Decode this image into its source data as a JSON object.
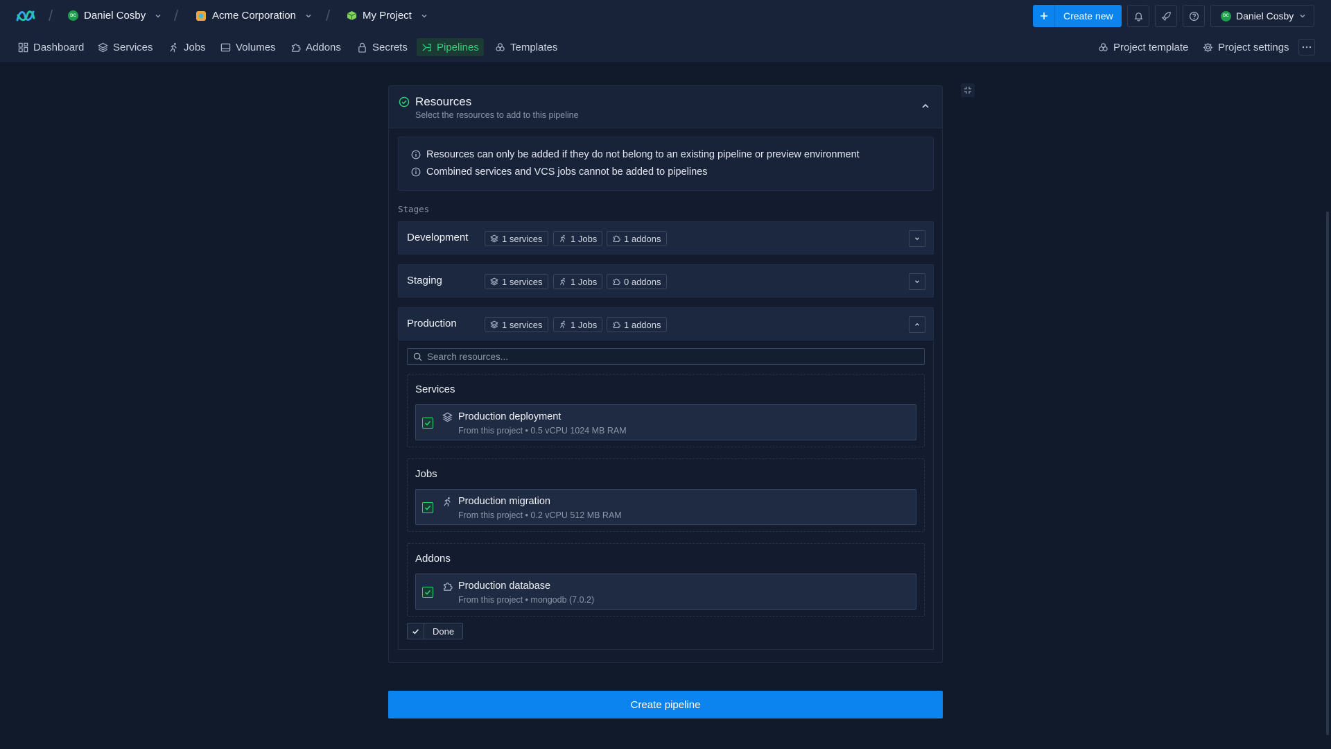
{
  "header": {
    "user_crumb": "Daniel Cosby",
    "user_initials": "DC",
    "org_crumb": "Acme Corporation",
    "project_crumb": "My Project",
    "create_new_label": "Create new",
    "account_name": "Daniel Cosby"
  },
  "nav": {
    "items": [
      "Dashboard",
      "Services",
      "Jobs",
      "Volumes",
      "Addons",
      "Secrets",
      "Pipelines",
      "Templates"
    ],
    "active": "Pipelines",
    "project_template": "Project template",
    "project_settings": "Project settings"
  },
  "resources": {
    "title": "Resources",
    "subtitle": "Select the resources to add to this pipeline",
    "info": [
      "Resources can only be added if they do not belong to an existing pipeline or preview environment",
      "Combined services and VCS jobs cannot be added to pipelines"
    ],
    "stages_label": "Stages",
    "stages": [
      {
        "name": "Development",
        "services": "1 services",
        "jobs": "1 Jobs",
        "addons": "1 addons",
        "expanded": false
      },
      {
        "name": "Staging",
        "services": "1 services",
        "jobs": "1 Jobs",
        "addons": "0 addons",
        "expanded": false
      },
      {
        "name": "Production",
        "services": "1 services",
        "jobs": "1 Jobs",
        "addons": "1 addons",
        "expanded": true
      }
    ],
    "search_placeholder": "Search resources...",
    "groups": [
      {
        "title": "Services",
        "item": {
          "name": "Production deployment",
          "meta": "From this project • 0.5 vCPU 1024 MB RAM",
          "checked": true
        }
      },
      {
        "title": "Jobs",
        "item": {
          "name": "Production migration",
          "meta": "From this project • 0.2 vCPU 512 MB RAM",
          "checked": true
        }
      },
      {
        "title": "Addons",
        "item": {
          "name": "Production database",
          "meta": "From this project • mongodb (7.0.2)",
          "checked": true
        }
      }
    ],
    "done_label": "Done"
  },
  "create_pipeline_label": "Create pipeline",
  "colors": {
    "accent": "#0b84f0",
    "success": "#2fd07a",
    "background": "#111a2b",
    "panel": "#18233a"
  }
}
